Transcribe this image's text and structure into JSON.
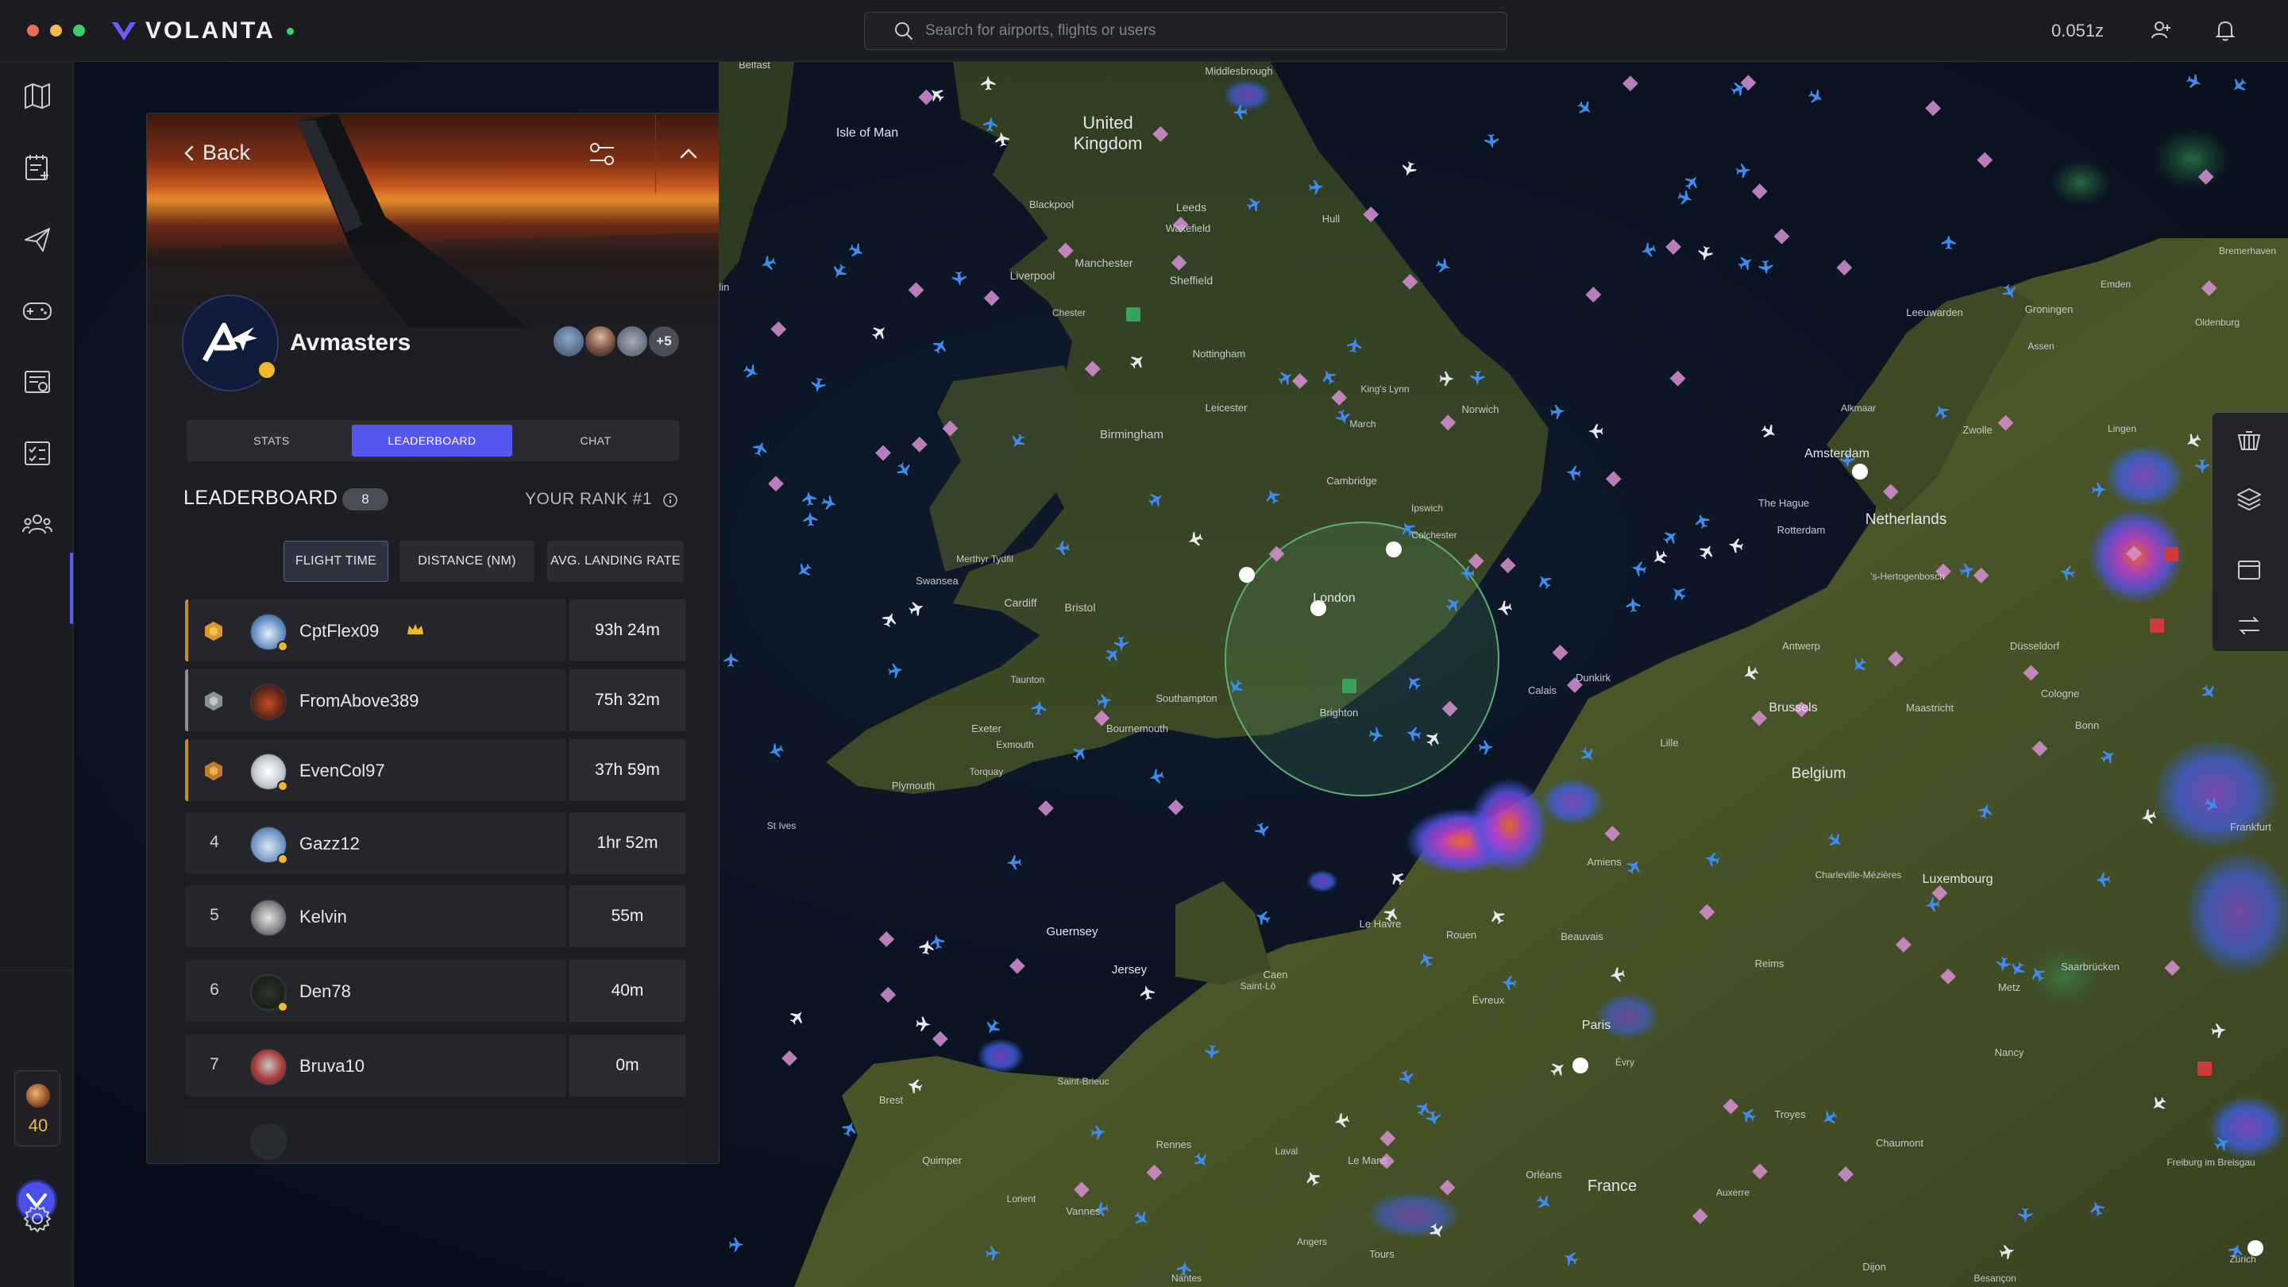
{
  "app": {
    "name": "VOLANTA",
    "accent": "#5557ee",
    "status_dot": "#3ccf6e"
  },
  "topbar": {
    "search_placeholder": "Search for airports, flights or users",
    "zulu_time": "0.051z",
    "icons": [
      "search-icon",
      "friends-icon",
      "bell-icon"
    ]
  },
  "rail": {
    "items": [
      "map-icon",
      "logbook-icon",
      "flights-icon",
      "gamepad-icon",
      "reports-icon",
      "checklist-icon",
      "groups-icon"
    ],
    "active": "groups-icon",
    "user_level": "40"
  },
  "panel": {
    "back_label": "Back",
    "group_name": "Avmasters",
    "more_members": "+5",
    "tabs": [
      {
        "label": "STATS",
        "active": false
      },
      {
        "label": "LEADERBOARD",
        "active": true
      },
      {
        "label": "CHAT",
        "active": false
      }
    ],
    "leaderboard": {
      "title": "LEADERBOARD",
      "count": "8",
      "your_rank": "YOUR RANK #1",
      "metrics": [
        {
          "label": "FLIGHT TIME",
          "active": true
        },
        {
          "label": "DISTANCE (NM)",
          "active": false
        },
        {
          "label": "AVG. LANDING RATE",
          "active": false
        }
      ],
      "rows": [
        {
          "rank": "1",
          "medal": "gold",
          "name": "CptFlex09",
          "crown": true,
          "time": "93h 24m"
        },
        {
          "rank": "2",
          "medal": "silver",
          "name": "FromAbove389",
          "crown": false,
          "time": "75h 32m"
        },
        {
          "rank": "3",
          "medal": "bronze",
          "name": "EvenCol97",
          "crown": false,
          "time": "37h 59m"
        },
        {
          "rank": "4",
          "medal": "",
          "name": "Gazz12",
          "crown": false,
          "time": "1hr 52m"
        },
        {
          "rank": "5",
          "medal": "",
          "name": "Kelvin",
          "crown": false,
          "time": "55m"
        },
        {
          "rank": "6",
          "medal": "",
          "name": "Den78",
          "crown": false,
          "time": "40m"
        },
        {
          "rank": "7",
          "medal": "",
          "name": "Bruva10",
          "crown": false,
          "time": "0m"
        }
      ]
    }
  },
  "map": {
    "labels": {
      "uk": "United Kingdom",
      "isle_of_man": "Isle of Man",
      "netherlands": "Netherlands",
      "amsterdam": "Amsterdam",
      "belgium": "Belgium",
      "brussels": "Brussels",
      "france": "France",
      "paris": "Paris",
      "london": "London",
      "luxembourg": "Luxembourg",
      "guernsey": "Guernsey",
      "jersey": "Jersey",
      "leeds": "Leeds",
      "manchester": "Manchester",
      "liverpool": "Liverpool",
      "sheffield": "Sheffield",
      "nottingham": "Nottingham",
      "birmingham": "Birmingham",
      "leicester": "Leicester",
      "cambridge": "Cambridge",
      "norwich": "Norwich",
      "ipswich": "Ipswich",
      "colchester": "Colchester",
      "cardiff": "Cardiff",
      "bristol": "Bristol",
      "swansea": "Swansea",
      "southampton": "Southampton",
      "brighton": "Brighton",
      "bournemouth": "Bournemouth",
      "plymouth": "Plymouth",
      "exeter": "Exeter",
      "torquay": "Torquay",
      "taunton": "Taunton",
      "calais": "Calais",
      "dunkirk": "Dunkirk",
      "lille": "Lille",
      "amiens": "Amiens",
      "rouen": "Rouen",
      "caen": "Caen",
      "reims": "Reims",
      "brest": "Brest",
      "rennes": "Rennes",
      "nantes": "Nantes",
      "le_mans": "Le Mans",
      "tours": "Tours",
      "orleans": "Orléans",
      "the_hague": "The Hague",
      "rotterdam": "Rotterdam",
      "antwerp": "Antwerp",
      "cologne": "Cologne",
      "bonn": "Bonn",
      "dusseldorf": "Düsseldorf",
      "zwolle": "Zwolle",
      "groningen": "Groningen",
      "leeuwarden": "Leeuwarden",
      "maastricht": "Maastricht",
      "nancy": "Nancy",
      "metz": "Metz",
      "troyes": "Troyes",
      "hull": "Hull",
      "kings_lynn": "King's Lynn",
      "middlesbrough": "Middlesbrough",
      "blackpool": "Blackpool",
      "chester": "Chester",
      "alkmaar": "Alkmaar",
      "frankfurt": "Frankfurt",
      "saarbrucken": "Saarbrücken",
      "le_havre": "Le Havre",
      "beauvais": "Beauvais",
      "evreux": "Évreux",
      "quimper": "Quimper",
      "vannes": "Vannes",
      "lorient": "Lorient",
      "saint_lo": "Saint-Lô",
      "saint_brieuc": "Saint-Brieuc",
      "chaumont": "Chaumont",
      "dijon": "Dijon",
      "auxerre": "Auxerre",
      "angers": "Angers",
      "laval": "Laval",
      "evry": "Évry",
      "charleville": "Charleville-Mézières",
      "hertogenbosch": "'s-Hertogenbosch",
      "oldenburg": "Oldenburg",
      "assen": "Assen",
      "lingen": "Lingen",
      "emden": "Emden",
      "bremerhaven": "Bremerhaven",
      "freiburg": "Freiburg im Breisgau",
      "zurich": "Zürich",
      "besancon": "Besançon",
      "march": "March",
      "wakefield": "Wakefield",
      "merthyr": "Merthyr Tydfil",
      "exmouth": "Exmouth",
      "st_ives": "St Ives",
      "belfast": "Belfast",
      "dublin": "Dublin"
    }
  }
}
